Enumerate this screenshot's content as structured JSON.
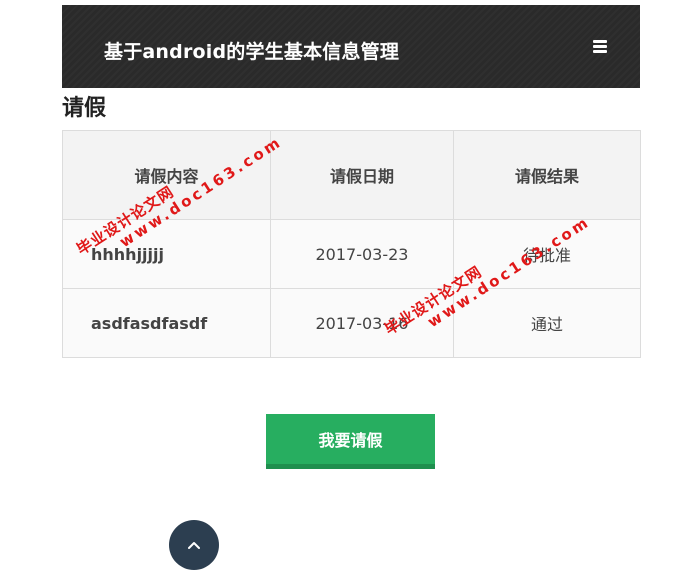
{
  "header": {
    "title": "基于android的学生基本信息管理",
    "menu_icon": "hamburger-menu-icon"
  },
  "page": {
    "heading": "请假"
  },
  "table": {
    "columns": [
      "请假内容",
      "请假日期",
      "请假结果"
    ],
    "rows": [
      {
        "content": "hhhhjjjjj",
        "date": "2017-03-23",
        "result": "待批准"
      },
      {
        "content": "asdfasdfasdf",
        "date": "2017-03-16",
        "result": "通过"
      }
    ]
  },
  "actions": {
    "request_leave_label": "我要请假",
    "scroll_top_icon": "chevron-up-icon"
  },
  "watermarks": [
    {
      "cn": "毕业设计论文网",
      "url": "www.doc163.com"
    },
    {
      "cn": "毕业设计论文网",
      "url": "www.doc163.com"
    }
  ],
  "colors": {
    "header_bg": "#2a2a2a",
    "button_green": "#27ae60",
    "scroll_button": "#2c3e50",
    "watermark_red": "#e01818"
  }
}
